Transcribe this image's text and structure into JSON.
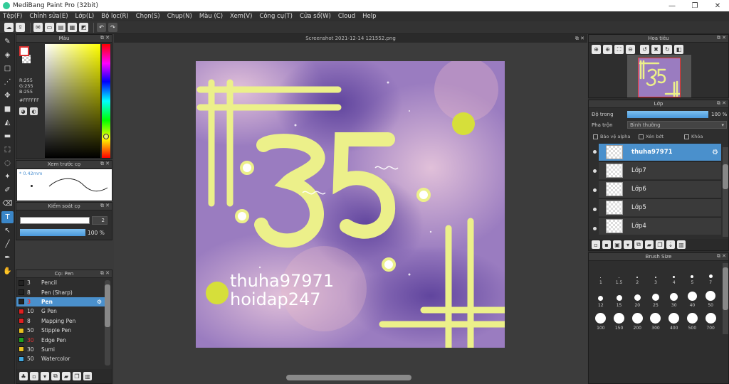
{
  "window": {
    "title": "MediBang Paint Pro (32bit)"
  },
  "menu": [
    "Tệp(F)",
    "Chỉnh sửa(E)",
    "Lớp(L)",
    "Bộ lọc(R)",
    "Chọn(S)",
    "Chụp(N)",
    "Màu (C)",
    "Xem(V)",
    "Công cụ(T)",
    "Cửa sổ(W)",
    "Cloud",
    "Help"
  ],
  "color_panel": {
    "title": "Màu",
    "r": "R:255",
    "g": "G:255",
    "b": "B:255",
    "hex": "#FFFFFF"
  },
  "preview_panel": {
    "title": "Xem trước cọ",
    "size": "* 0.42mm"
  },
  "control_panel": {
    "title": "Kiểm soát cọ",
    "size_value": "2",
    "opacity_value": "100 %"
  },
  "brush_panel": {
    "title": "Cọ: Pen",
    "items": [
      {
        "size": "3",
        "name": "Pencil",
        "color": "#222222"
      },
      {
        "size": "8",
        "name": "Pen (Sharp)",
        "color": "#222222"
      },
      {
        "size": "3",
        "name": "Pen",
        "color": "#222222"
      },
      {
        "size": "10",
        "name": "G Pen",
        "color": "#e02020"
      },
      {
        "size": "8",
        "name": "Mapping Pen",
        "color": "#e02020"
      },
      {
        "size": "50",
        "name": "Stipple Pen",
        "color": "#e8c020"
      },
      {
        "size": "30",
        "name": "Edge Pen",
        "color": "#20a020"
      },
      {
        "size": "30",
        "name": "Sumi",
        "color": "#e8c020"
      },
      {
        "size": "50",
        "name": "Watercolor",
        "color": "#40a8e0"
      }
    ]
  },
  "document": {
    "tab": "Screenshot 2021-12-14 121552.png"
  },
  "artwork": {
    "number": "35",
    "line1": "thuha97971",
    "line2": "hoidap247"
  },
  "navigator": {
    "title": "Hoa tiêu"
  },
  "layers_panel": {
    "title": "Lớp",
    "opacity_label": "Độ trong",
    "opacity_value": "100 %",
    "blend_label": "Pha trộn",
    "blend_value": "Bình thường",
    "protect_alpha": "Bảo vệ alpha",
    "clip": "Xén bớt",
    "lock": "Khóa",
    "layers": [
      {
        "name": "thuha97971"
      },
      {
        "name": "Lớp7"
      },
      {
        "name": "Lớp6"
      },
      {
        "name": "Lớp5"
      },
      {
        "name": "Lớp4"
      }
    ]
  },
  "brush_size_panel": {
    "title": "Brush Size",
    "sizes": [
      "1",
      "1.5",
      "2",
      "3",
      "4",
      "5",
      "7",
      "12",
      "15",
      "20",
      "25",
      "30",
      "40",
      "50",
      "100",
      "150",
      "200",
      "300",
      "400",
      "500",
      "700"
    ]
  }
}
